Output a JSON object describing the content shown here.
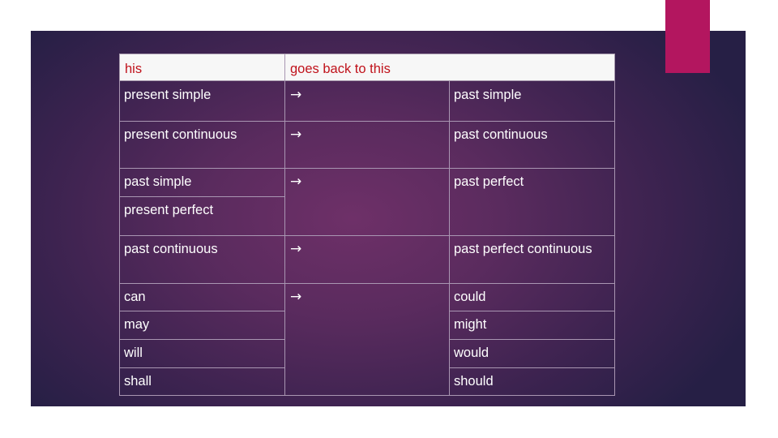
{
  "colors": {
    "accent_bar": "#b3165f",
    "header_text": "#c0121b",
    "body_text": "#ffffff",
    "header_bg": "#f7f7f7",
    "panel_dark": "#261f45",
    "panel_mid": "#6e3068"
  },
  "table": {
    "headers": [
      "his",
      "goes back to this"
    ],
    "arrow_icon": "→",
    "rows": [
      {
        "from": [
          "present simple"
        ],
        "arrow": "→",
        "to": [
          "past simple"
        ]
      },
      {
        "from": [
          "present continuous"
        ],
        "arrow": "→",
        "to": [
          "past continuous"
        ]
      },
      {
        "from": [
          "past simple",
          "present perfect"
        ],
        "arrow": "→",
        "to": [
          "past perfect"
        ]
      },
      {
        "from": [
          "past continuous"
        ],
        "arrow": "→",
        "to": [
          "past perfect continuous"
        ]
      },
      {
        "from": [
          "can",
          "may",
          "will",
          "shall"
        ],
        "arrow": "→",
        "to": [
          "could",
          "might",
          "would",
          "should"
        ]
      }
    ]
  }
}
